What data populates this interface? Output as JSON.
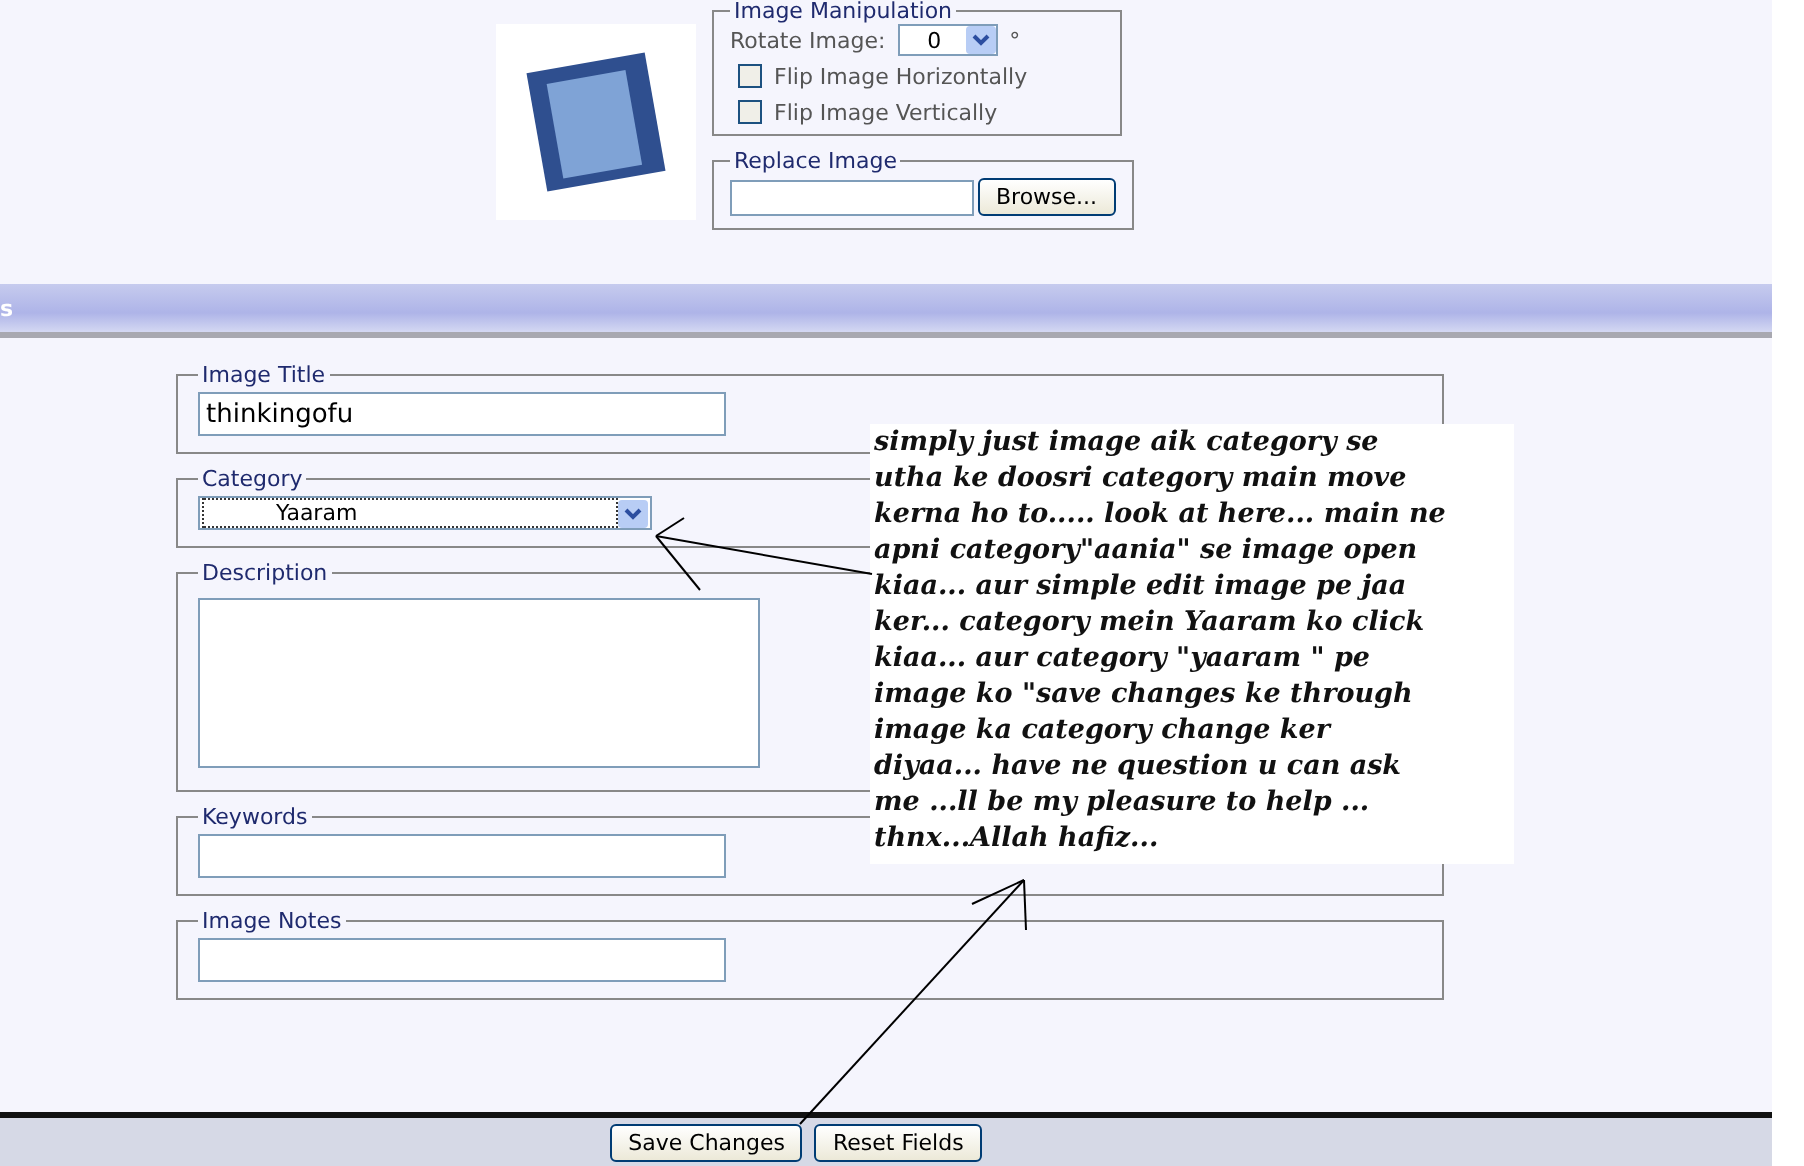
{
  "image_manipulation": {
    "title": "Image Manipulation",
    "rotate_label": "Rotate Image:",
    "rotate_value": "0",
    "degree_sign": "°",
    "options": [
      {
        "label": "Flip Image Horizontally",
        "checked": false
      },
      {
        "label": "Flip Image Vertically",
        "checked": false
      }
    ]
  },
  "replace_image": {
    "title": "Replace Image",
    "button": "Browse..."
  },
  "section_header": {
    "title": "s"
  },
  "fields": [
    {
      "kind": "text",
      "label": "Image Title",
      "value": "thinkingofu"
    },
    {
      "kind": "select",
      "label": "Category",
      "value": "Yaaram"
    },
    {
      "kind": "textarea",
      "label": "Description"
    },
    {
      "kind": "text",
      "label": "Keywords"
    },
    {
      "kind": "text",
      "label": "Image Notes"
    }
  ],
  "buttons": [
    "Save Changes",
    "Reset Fields"
  ],
  "annotation": {
    "lines": [
      "simply just image aik category se",
      "utha ke doosri category main move",
      "kerna ho to..... look at here... main ne",
      "apni category\"aania\" se image open",
      "kiaa... aur simple edit image pe jaa",
      "ker... category mein Yaaram ko click",
      "kiaa... aur category \"yaaram  \" pe",
      "image ko \"save changes ke through",
      "image ka category change ker",
      "diyaa... have ne question u can ask",
      "me ...ll be my pleasure to help ...",
      "thnx...Allah hafiz..."
    ]
  }
}
